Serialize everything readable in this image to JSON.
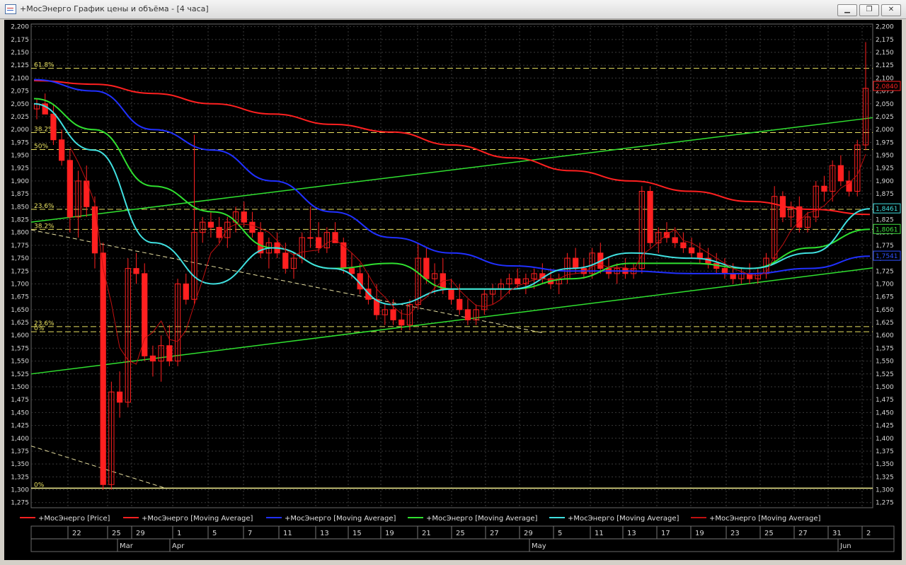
{
  "window": {
    "title": "+МосЭнерго График цены и объёма - [4 часа]",
    "icon": "chart-window-icon",
    "buttons": [
      {
        "name": "minimize-button",
        "glyph": "▁"
      },
      {
        "name": "restore-button",
        "glyph": "❐"
      },
      {
        "name": "close-button",
        "glyph": "✕"
      }
    ]
  },
  "chart_data": {
    "type": "line",
    "title": "",
    "y_ticks": [
      "2,200",
      "2,175",
      "2,150",
      "2,125",
      "2,100",
      "2,075",
      "2,050",
      "2,025",
      "2,000",
      "1,975",
      "1,950",
      "1,925",
      "1,900",
      "1,875",
      "1,850",
      "1,825",
      "1,800",
      "1,775",
      "1,750",
      "1,725",
      "1,700",
      "1,675",
      "1,650",
      "1,625",
      "1,600",
      "1,575",
      "1,550",
      "1,525",
      "1,500",
      "1,475",
      "1,450",
      "1,425",
      "1,400",
      "1,375",
      "1,350",
      "1,325",
      "1,300",
      "1,275"
    ],
    "ylim": [
      1.265,
      2.205
    ],
    "grid": true,
    "x_ticks": [
      "22",
      "25",
      "29",
      "1",
      "5",
      "7",
      "11",
      "13",
      "15",
      "19",
      "21",
      "25",
      "27",
      "29",
      "5",
      "11",
      "13",
      "17",
      "19",
      "23",
      "25",
      "27",
      "31",
      "2"
    ],
    "month_labels": [
      "Mar",
      "Apr",
      "May",
      "Jun"
    ],
    "fib_levels_upper": [
      {
        "label": "61.8%",
        "value": 2.119
      },
      {
        "label": "38.2%",
        "value": 1.994
      },
      {
        "label": "50%",
        "value": 1.961
      },
      {
        "label": "23.6%",
        "value": 1.845
      },
      {
        "label": "38.2%",
        "value": 1.806
      },
      {
        "label": "23.6%",
        "value": 1.617
      },
      {
        "label": "0%",
        "value": 1.607
      }
    ],
    "fib_levels_lower": [
      {
        "label": "0%",
        "value": 1.303
      }
    ],
    "price_tags": [
      {
        "value": "2,0840",
        "color": "#ff2020"
      },
      {
        "value": "1,8461",
        "color": "#40e0e0"
      },
      {
        "value": "1,8061",
        "color": "#40e040"
      },
      {
        "value": "1,7541",
        "color": "#3050ff"
      }
    ],
    "candles": [
      {
        "o": 2.04,
        "h": 2.06,
        "l": 2.02,
        "c": 2.05
      },
      {
        "o": 2.05,
        "h": 2.07,
        "l": 2.03,
        "c": 2.03
      },
      {
        "o": 2.03,
        "h": 2.05,
        "l": 1.97,
        "c": 1.98
      },
      {
        "o": 1.98,
        "h": 2.0,
        "l": 1.93,
        "c": 1.94
      },
      {
        "o": 1.94,
        "h": 1.96,
        "l": 1.8,
        "c": 1.83
      },
      {
        "o": 1.83,
        "h": 1.92,
        "l": 1.79,
        "c": 1.9
      },
      {
        "o": 1.9,
        "h": 1.93,
        "l": 1.83,
        "c": 1.85
      },
      {
        "o": 1.85,
        "h": 1.87,
        "l": 1.73,
        "c": 1.76
      },
      {
        "o": 1.76,
        "h": 1.78,
        "l": 1.3,
        "c": 1.31
      },
      {
        "o": 1.31,
        "h": 1.51,
        "l": 1.3,
        "c": 1.49
      },
      {
        "o": 1.49,
        "h": 1.53,
        "l": 1.44,
        "c": 1.47
      },
      {
        "o": 1.47,
        "h": 1.75,
        "l": 1.46,
        "c": 1.73
      },
      {
        "o": 1.73,
        "h": 1.76,
        "l": 1.7,
        "c": 1.72
      },
      {
        "o": 1.72,
        "h": 1.74,
        "l": 1.55,
        "c": 1.56
      },
      {
        "o": 1.56,
        "h": 1.58,
        "l": 1.52,
        "c": 1.55
      },
      {
        "o": 1.55,
        "h": 1.6,
        "l": 1.51,
        "c": 1.58
      },
      {
        "o": 1.58,
        "h": 1.62,
        "l": 1.54,
        "c": 1.55
      },
      {
        "o": 1.55,
        "h": 1.71,
        "l": 1.54,
        "c": 1.7
      },
      {
        "o": 1.7,
        "h": 1.72,
        "l": 1.66,
        "c": 1.67
      },
      {
        "o": 1.67,
        "h": 1.99,
        "l": 1.66,
        "c": 1.8
      },
      {
        "o": 1.8,
        "h": 1.83,
        "l": 1.78,
        "c": 1.82
      },
      {
        "o": 1.82,
        "h": 1.84,
        "l": 1.79,
        "c": 1.81
      },
      {
        "o": 1.81,
        "h": 1.83,
        "l": 1.78,
        "c": 1.79
      },
      {
        "o": 1.79,
        "h": 1.83,
        "l": 1.77,
        "c": 1.82
      },
      {
        "o": 1.82,
        "h": 1.85,
        "l": 1.8,
        "c": 1.84
      },
      {
        "o": 1.84,
        "h": 1.86,
        "l": 1.81,
        "c": 1.82
      },
      {
        "o": 1.82,
        "h": 1.84,
        "l": 1.79,
        "c": 1.8
      },
      {
        "o": 1.8,
        "h": 1.82,
        "l": 1.75,
        "c": 1.76
      },
      {
        "o": 1.76,
        "h": 1.79,
        "l": 1.73,
        "c": 1.78
      },
      {
        "o": 1.78,
        "h": 1.8,
        "l": 1.75,
        "c": 1.76
      },
      {
        "o": 1.76,
        "h": 1.78,
        "l": 1.72,
        "c": 1.73
      },
      {
        "o": 1.73,
        "h": 1.76,
        "l": 1.71,
        "c": 1.75
      },
      {
        "o": 1.75,
        "h": 1.8,
        "l": 1.74,
        "c": 1.79
      },
      {
        "o": 1.79,
        "h": 1.85,
        "l": 1.77,
        "c": 1.79
      },
      {
        "o": 1.79,
        "h": 1.82,
        "l": 1.76,
        "c": 1.77
      },
      {
        "o": 1.77,
        "h": 1.81,
        "l": 1.76,
        "c": 1.8
      },
      {
        "o": 1.8,
        "h": 1.82,
        "l": 1.78,
        "c": 1.78
      },
      {
        "o": 1.78,
        "h": 1.79,
        "l": 1.72,
        "c": 1.73
      },
      {
        "o": 1.73,
        "h": 1.76,
        "l": 1.71,
        "c": 1.72
      },
      {
        "o": 1.72,
        "h": 1.74,
        "l": 1.68,
        "c": 1.69
      },
      {
        "o": 1.69,
        "h": 1.72,
        "l": 1.66,
        "c": 1.67
      },
      {
        "o": 1.67,
        "h": 1.7,
        "l": 1.63,
        "c": 1.64
      },
      {
        "o": 1.64,
        "h": 1.66,
        "l": 1.62,
        "c": 1.65
      },
      {
        "o": 1.65,
        "h": 1.67,
        "l": 1.62,
        "c": 1.63
      },
      {
        "o": 1.63,
        "h": 1.65,
        "l": 1.61,
        "c": 1.62
      },
      {
        "o": 1.62,
        "h": 1.67,
        "l": 1.61,
        "c": 1.66
      },
      {
        "o": 1.66,
        "h": 1.78,
        "l": 1.65,
        "c": 1.75
      },
      {
        "o": 1.75,
        "h": 1.77,
        "l": 1.7,
        "c": 1.71
      },
      {
        "o": 1.71,
        "h": 1.74,
        "l": 1.68,
        "c": 1.72
      },
      {
        "o": 1.72,
        "h": 1.75,
        "l": 1.68,
        "c": 1.69
      },
      {
        "o": 1.69,
        "h": 1.71,
        "l": 1.66,
        "c": 1.67
      },
      {
        "o": 1.67,
        "h": 1.7,
        "l": 1.64,
        "c": 1.65
      },
      {
        "o": 1.65,
        "h": 1.67,
        "l": 1.62,
        "c": 1.63
      },
      {
        "o": 1.63,
        "h": 1.66,
        "l": 1.62,
        "c": 1.65
      },
      {
        "o": 1.65,
        "h": 1.69,
        "l": 1.64,
        "c": 1.68
      },
      {
        "o": 1.68,
        "h": 1.7,
        "l": 1.66,
        "c": 1.69
      },
      {
        "o": 1.69,
        "h": 1.71,
        "l": 1.67,
        "c": 1.7
      },
      {
        "o": 1.7,
        "h": 1.72,
        "l": 1.68,
        "c": 1.71
      },
      {
        "o": 1.71,
        "h": 1.73,
        "l": 1.69,
        "c": 1.7
      },
      {
        "o": 1.7,
        "h": 1.72,
        "l": 1.68,
        "c": 1.71
      },
      {
        "o": 1.71,
        "h": 1.73,
        "l": 1.69,
        "c": 1.72
      },
      {
        "o": 1.72,
        "h": 1.74,
        "l": 1.7,
        "c": 1.71
      },
      {
        "o": 1.71,
        "h": 1.73,
        "l": 1.69,
        "c": 1.7
      },
      {
        "o": 1.7,
        "h": 1.72,
        "l": 1.68,
        "c": 1.71
      },
      {
        "o": 1.71,
        "h": 1.76,
        "l": 1.7,
        "c": 1.75
      },
      {
        "o": 1.75,
        "h": 1.77,
        "l": 1.72,
        "c": 1.73
      },
      {
        "o": 1.73,
        "h": 1.75,
        "l": 1.71,
        "c": 1.72
      },
      {
        "o": 1.72,
        "h": 1.77,
        "l": 1.71,
        "c": 1.76
      },
      {
        "o": 1.76,
        "h": 1.78,
        "l": 1.72,
        "c": 1.73
      },
      {
        "o": 1.73,
        "h": 1.75,
        "l": 1.71,
        "c": 1.72
      },
      {
        "o": 1.72,
        "h": 1.74,
        "l": 1.7,
        "c": 1.73
      },
      {
        "o": 1.73,
        "h": 1.75,
        "l": 1.71,
        "c": 1.72
      },
      {
        "o": 1.72,
        "h": 1.74,
        "l": 1.71,
        "c": 1.73
      },
      {
        "o": 1.73,
        "h": 1.89,
        "l": 1.72,
        "c": 1.88
      },
      {
        "o": 1.88,
        "h": 1.89,
        "l": 1.77,
        "c": 1.78
      },
      {
        "o": 1.78,
        "h": 1.81,
        "l": 1.76,
        "c": 1.8
      },
      {
        "o": 1.8,
        "h": 1.82,
        "l": 1.78,
        "c": 1.79
      },
      {
        "o": 1.79,
        "h": 1.81,
        "l": 1.77,
        "c": 1.78
      },
      {
        "o": 1.78,
        "h": 1.8,
        "l": 1.76,
        "c": 1.77
      },
      {
        "o": 1.77,
        "h": 1.79,
        "l": 1.75,
        "c": 1.76
      },
      {
        "o": 1.76,
        "h": 1.78,
        "l": 1.74,
        "c": 1.75
      },
      {
        "o": 1.75,
        "h": 1.77,
        "l": 1.73,
        "c": 1.74
      },
      {
        "o": 1.74,
        "h": 1.76,
        "l": 1.72,
        "c": 1.73
      },
      {
        "o": 1.73,
        "h": 1.75,
        "l": 1.71,
        "c": 1.72
      },
      {
        "o": 1.72,
        "h": 1.74,
        "l": 1.7,
        "c": 1.71
      },
      {
        "o": 1.71,
        "h": 1.73,
        "l": 1.7,
        "c": 1.72
      },
      {
        "o": 1.72,
        "h": 1.74,
        "l": 1.7,
        "c": 1.71
      },
      {
        "o": 1.71,
        "h": 1.73,
        "l": 1.7,
        "c": 1.72
      },
      {
        "o": 1.72,
        "h": 1.76,
        "l": 1.71,
        "c": 1.75
      },
      {
        "o": 1.75,
        "h": 1.89,
        "l": 1.74,
        "c": 1.87
      },
      {
        "o": 1.87,
        "h": 1.88,
        "l": 1.82,
        "c": 1.83
      },
      {
        "o": 1.83,
        "h": 1.86,
        "l": 1.81,
        "c": 1.85
      },
      {
        "o": 1.85,
        "h": 1.87,
        "l": 1.8,
        "c": 1.81
      },
      {
        "o": 1.81,
        "h": 1.84,
        "l": 1.8,
        "c": 1.83
      },
      {
        "o": 1.83,
        "h": 1.9,
        "l": 1.82,
        "c": 1.89
      },
      {
        "o": 1.89,
        "h": 1.91,
        "l": 1.86,
        "c": 1.88
      },
      {
        "o": 1.88,
        "h": 1.94,
        "l": 1.86,
        "c": 1.93
      },
      {
        "o": 1.93,
        "h": 1.95,
        "l": 1.89,
        "c": 1.9
      },
      {
        "o": 1.9,
        "h": 1.92,
        "l": 1.87,
        "c": 1.88
      },
      {
        "o": 1.88,
        "h": 1.98,
        "l": 1.87,
        "c": 1.97
      },
      {
        "o": 1.97,
        "h": 2.17,
        "l": 1.96,
        "c": 2.08
      }
    ],
    "series": [
      {
        "name": "+МосЭнерго [Price]",
        "color": "#ff2020"
      },
      {
        "name": "+МосЭнерго [Moving Average]",
        "color": "#ff2020",
        "values": [
          2.095,
          2.088,
          2.07,
          2.05,
          2.03,
          2.01,
          1.995,
          1.97,
          1.945,
          1.92,
          1.9,
          1.88,
          1.86,
          1.845,
          1.835
        ]
      },
      {
        "name": "+МосЭнерго [Moving Average]",
        "color": "#2030ff",
        "values": [
          2.097,
          2.075,
          2.0,
          1.96,
          1.9,
          1.84,
          1.79,
          1.76,
          1.735,
          1.725,
          1.725,
          1.72,
          1.72,
          1.73,
          1.754
        ]
      },
      {
        "name": "+МосЭнерго [Moving Average]",
        "color": "#30e030",
        "values": [
          2.06,
          2.0,
          1.89,
          1.84,
          1.77,
          1.73,
          1.74,
          1.69,
          1.69,
          1.71,
          1.74,
          1.74,
          1.73,
          1.77,
          1.806
        ]
      },
      {
        "name": "+МосЭнерго [Moving Average]",
        "color": "#40e0e0",
        "values": [
          2.05,
          1.96,
          1.78,
          1.7,
          1.77,
          1.73,
          1.66,
          1.69,
          1.69,
          1.73,
          1.76,
          1.75,
          1.73,
          1.76,
          1.846
        ]
      },
      {
        "name": "+МосЭнерго [Moving Average]",
        "color": "#c01010"
      }
    ]
  }
}
